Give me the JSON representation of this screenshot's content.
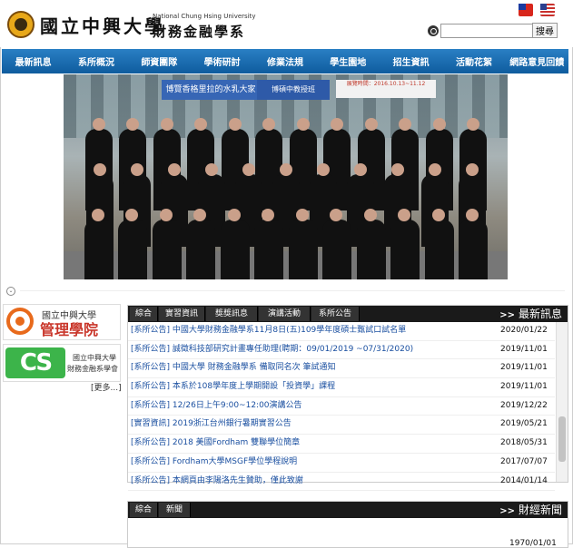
{
  "header": {
    "school_cn": "國立中興大學",
    "school_en": "National Chung Hsing University",
    "dept_cn": "財務金融學系",
    "search": {
      "placeholder": "",
      "button": "搜尋"
    }
  },
  "nav": [
    "最新訊息",
    "系所概況",
    "師資團隊",
    "學術研討",
    "修業法規",
    "學生園地",
    "招生資訊",
    "活動花絮",
    "網路意見回饋"
  ],
  "photo": {
    "banner_left": "博覽香格里拉的水乳大家",
    "banner_right": "博碩中教授班",
    "banner_small": "展覽時間：2016.10.13~11.12"
  },
  "sidebar": {
    "mgmt_top": "國立中興大學",
    "mgmt_main": "管理學院",
    "alumni_mark": "CS",
    "alumni_line1": "國立中興大學",
    "alumni_line2": "財務金融系學會",
    "more": "[更多...]"
  },
  "news": {
    "tabs": [
      "綜合",
      "實習資訊",
      "獎獎訊息",
      "演講活動",
      "系所公告"
    ],
    "title": "最新訊息",
    "title_mark": ">>",
    "items": [
      {
        "cat": "[系所公告]",
        "title": "中國大學財務金融學系11月8日(五)109學年度碩士甄試口試名單",
        "date": "2020/01/22"
      },
      {
        "cat": "[系所公告]",
        "title": "誠徵科技部研究計畫專任助理(聘期：09/01/2019 ~07/31/2020)",
        "date": "2019/11/01"
      },
      {
        "cat": "[系所公告]",
        "title": "中國大學 財務金融學系 備取同名次 筆試通知",
        "date": "2019/11/01"
      },
      {
        "cat": "[系所公告]",
        "title": "本系於108學年度上學期開設「投資學」課程",
        "date": "2019/11/01"
      },
      {
        "cat": "[系所公告]",
        "title": "12/26日上午9:00~12:00演講公告",
        "date": "2019/12/22"
      },
      {
        "cat": "[實習資訊]",
        "title": "2019浙江台州銀行暑期實習公告",
        "date": "2019/05/21"
      },
      {
        "cat": "[系所公告]",
        "title": "2018 美國Fordham 雙聯學位簡章",
        "date": "2018/05/31"
      },
      {
        "cat": "[系所公告]",
        "title": "Fordham大學MSGF學位學程說明",
        "date": "2017/07/07"
      },
      {
        "cat": "[系所公告]",
        "title": "本網頁由李陽洛先生贊助，僅此致謝",
        "date": "2014/01/14"
      }
    ]
  },
  "finance": {
    "tabs": [
      "綜合",
      "新聞"
    ],
    "title": "財經新聞",
    "title_mark": ">>",
    "first_date": "1970/01/01"
  },
  "colors": {
    "nav": "#1f6fb2",
    "link": "#1a4fa0",
    "tabbar": "#1a1a1a"
  }
}
